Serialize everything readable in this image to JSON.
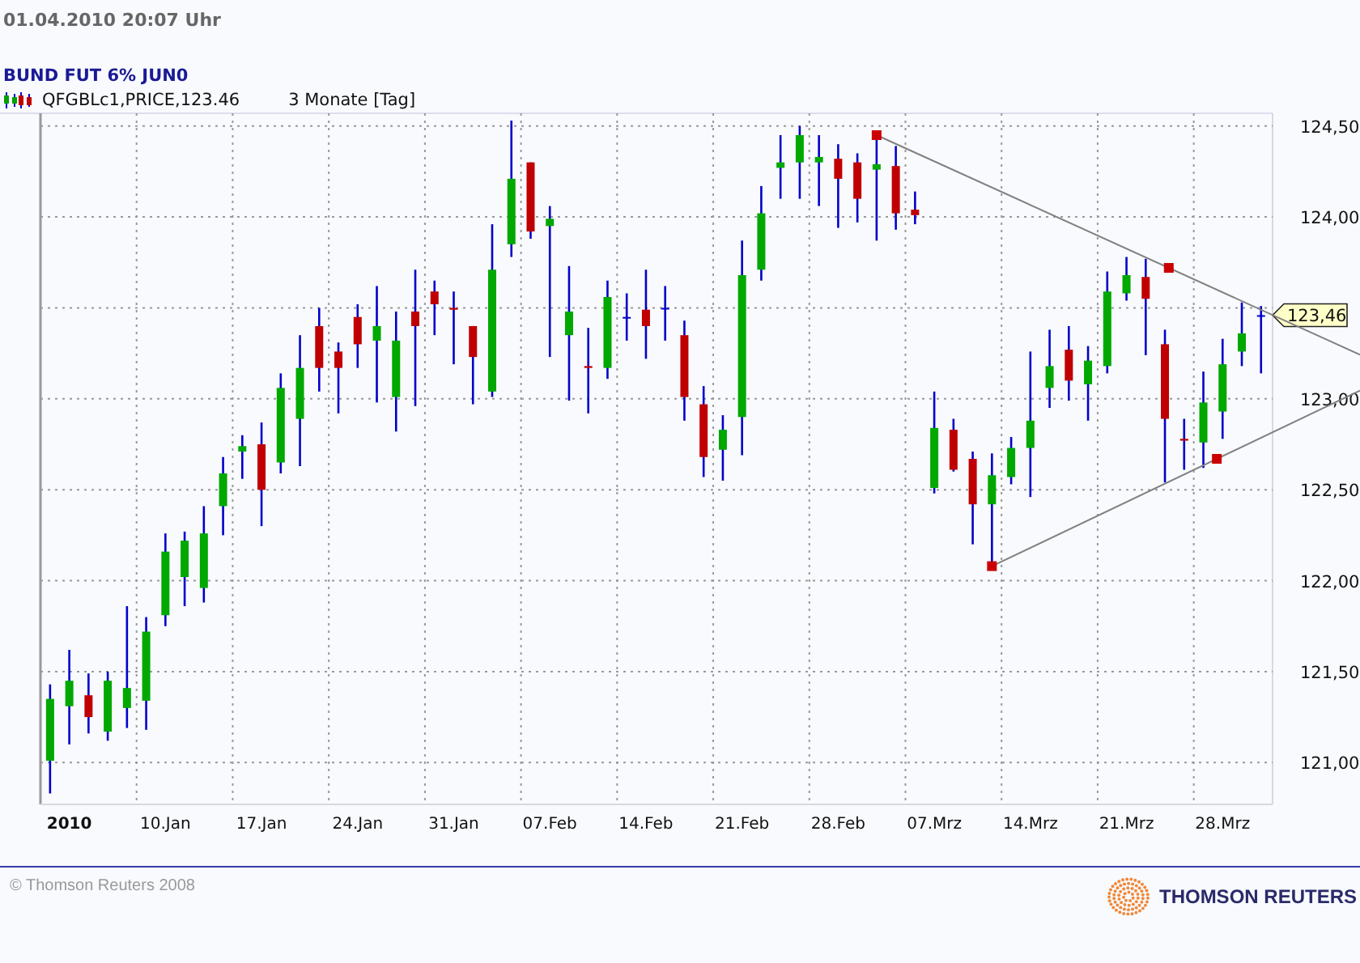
{
  "header": {
    "timestamp": "01.04.2010  20:07 Uhr",
    "instrument": "BUND FUT 6% JUN0"
  },
  "legend": {
    "series": "QFGBLc1,PRICE,123.46",
    "period": "3 Monate [Tag]"
  },
  "chart": {
    "chart_data": {
      "type": "candlestick",
      "grid": true,
      "ylim": [
        120.77,
        124.57
      ],
      "yticks": [
        {
          "value": 124.5,
          "label": "124,50"
        },
        {
          "value": 124,
          "label": "124,00"
        },
        {
          "value": 123,
          "label": "123,00"
        },
        {
          "value": 122.5,
          "label": "122,50"
        },
        {
          "value": 122,
          "label": "122,00"
        },
        {
          "value": 121.5,
          "label": "121,50"
        },
        {
          "value": 121,
          "label": "121,00"
        }
      ],
      "categories": [
        null,
        "2010",
        null,
        null,
        null,
        null,
        "10.Jan",
        null,
        null,
        null,
        null,
        "17.Jan",
        null,
        null,
        null,
        null,
        "24.Jan",
        null,
        null,
        null,
        null,
        "31.Jan",
        null,
        null,
        null,
        null,
        "07.Feb",
        null,
        null,
        null,
        null,
        "14.Feb",
        null,
        null,
        null,
        null,
        "21.Feb",
        null,
        null,
        null,
        null,
        "28.Feb",
        null,
        null,
        null,
        null,
        "07.Mrz",
        null,
        null,
        null,
        null,
        "14.Mrz",
        null,
        null,
        null,
        null,
        "21.Mrz",
        null,
        null,
        null,
        null,
        "28.Mrz",
        null,
        null
      ],
      "ohlc": [
        [
          121.01,
          121.43,
          120.83,
          121.35
        ],
        [
          121.31,
          121.62,
          121.1,
          121.45
        ],
        [
          121.37,
          121.49,
          121.16,
          121.25
        ],
        [
          121.17,
          121.5,
          121.12,
          121.45
        ],
        [
          121.3,
          121.86,
          121.19,
          121.41
        ],
        [
          121.34,
          121.8,
          121.18,
          121.72
        ],
        [
          121.81,
          122.26,
          121.75,
          122.16
        ],
        [
          122.02,
          122.27,
          121.86,
          122.22
        ],
        [
          121.96,
          122.41,
          121.88,
          122.26
        ],
        [
          122.41,
          122.68,
          122.25,
          122.59
        ],
        [
          122.71,
          122.8,
          122.56,
          122.74
        ],
        [
          122.75,
          122.87,
          122.3,
          122.5
        ],
        [
          122.65,
          123.14,
          122.59,
          123.06
        ],
        [
          122.89,
          123.35,
          122.63,
          123.17
        ],
        [
          123.4,
          123.5,
          123.04,
          123.17
        ],
        [
          123.26,
          123.31,
          122.92,
          123.17
        ],
        [
          123.45,
          123.52,
          123.17,
          123.3
        ],
        [
          123.32,
          123.62,
          122.98,
          123.4
        ],
        [
          123.01,
          123.48,
          122.82,
          123.32
        ],
        [
          123.48,
          123.71,
          122.96,
          123.4
        ],
        [
          123.59,
          123.65,
          123.35,
          123.52
        ],
        [
          123.5,
          123.59,
          123.19,
          123.49
        ],
        [
          123.4,
          123.4,
          122.97,
          123.23
        ],
        [
          123.04,
          123.96,
          123.01,
          123.71
        ],
        [
          123.85,
          124.53,
          123.78,
          124.21
        ],
        [
          124.3,
          124.3,
          123.88,
          123.92
        ],
        [
          123.95,
          124.06,
          123.23,
          123.99
        ],
        [
          123.35,
          123.73,
          122.99,
          123.48
        ],
        [
          123.18,
          123.39,
          122.92,
          123.17
        ],
        [
          123.17,
          123.65,
          123.11,
          123.56
        ],
        [
          123.45,
          123.58,
          123.32,
          123.45
        ],
        [
          123.49,
          123.71,
          123.22,
          123.4
        ],
        [
          123.5,
          123.62,
          123.32,
          123.5
        ],
        [
          123.35,
          123.43,
          122.88,
          123.01
        ],
        [
          122.97,
          123.07,
          122.57,
          122.68
        ],
        [
          122.72,
          122.91,
          122.55,
          122.83
        ],
        [
          122.9,
          123.87,
          122.69,
          123.68
        ],
        [
          123.71,
          124.17,
          123.65,
          124.02
        ],
        [
          124.27,
          124.45,
          124.1,
          124.3
        ],
        [
          124.3,
          124.5,
          124.1,
          124.45
        ],
        [
          124.3,
          124.45,
          124.06,
          124.33
        ],
        [
          124.32,
          124.4,
          123.94,
          124.21
        ],
        [
          124.3,
          124.35,
          123.97,
          124.1
        ],
        [
          124.26,
          124.45,
          123.87,
          124.29
        ],
        [
          124.28,
          124.39,
          123.93,
          124.02
        ],
        [
          124.04,
          124.14,
          123.96,
          124.01
        ],
        [
          122.51,
          123.04,
          122.48,
          122.84
        ],
        [
          122.83,
          122.89,
          122.6,
          122.61
        ],
        [
          122.67,
          122.71,
          122.2,
          122.42
        ],
        [
          122.42,
          122.7,
          122.08,
          122.58
        ],
        [
          122.57,
          122.79,
          122.53,
          122.73
        ],
        [
          122.73,
          123.26,
          122.46,
          122.88
        ],
        [
          123.06,
          123.38,
          122.95,
          123.18
        ],
        [
          123.27,
          123.4,
          122.99,
          123.1
        ],
        [
          123.08,
          123.29,
          122.88,
          123.21
        ],
        [
          123.18,
          123.7,
          123.14,
          123.59
        ],
        [
          123.58,
          123.78,
          123.54,
          123.68
        ],
        [
          123.67,
          123.77,
          123.24,
          123.55
        ],
        [
          123.3,
          123.38,
          122.54,
          122.89
        ],
        [
          122.78,
          122.89,
          122.61,
          122.77
        ],
        [
          122.76,
          123.15,
          122.62,
          122.98
        ],
        [
          122.93,
          123.33,
          122.78,
          123.19
        ],
        [
          123.26,
          123.53,
          123.18,
          123.36
        ],
        [
          123.46,
          123.51,
          123.14,
          123.46
        ]
      ]
    },
    "price_tag": {
      "label": "123,46"
    }
  },
  "footer": {
    "copyright": "© Thomson Reuters 2008",
    "brand": "THOMSON REUTERS"
  }
}
